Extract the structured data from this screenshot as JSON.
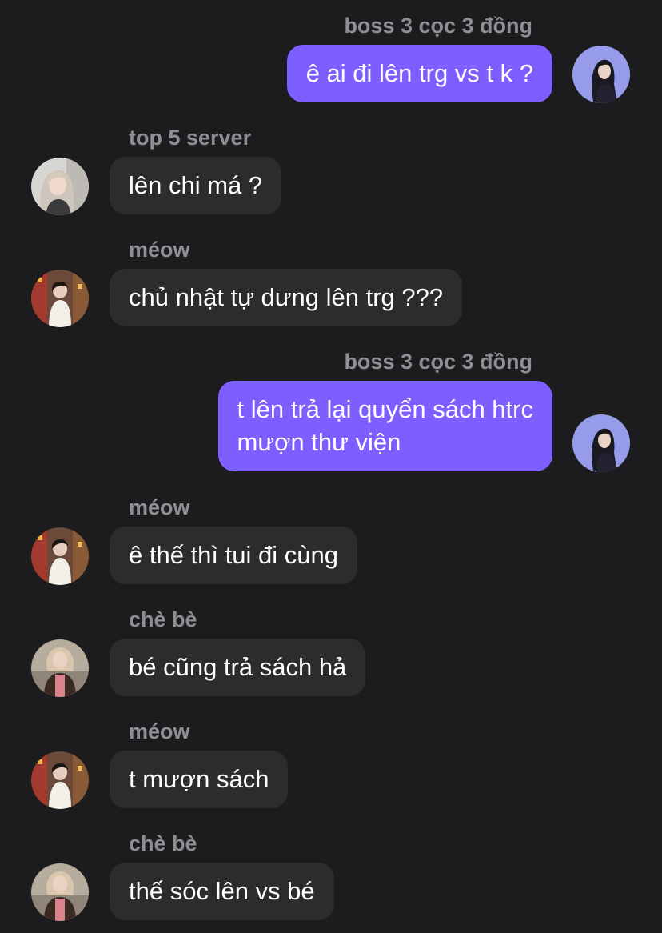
{
  "messages": [
    {
      "sender": "boss 3 cọc 3 đồng",
      "text": "ê ai đi lên trg vs t k ?",
      "direction": "outgoing",
      "avatar": "boss-avatar"
    },
    {
      "sender": "top 5 server",
      "text": "lên chi má ?",
      "direction": "incoming",
      "avatar": "top5-avatar"
    },
    {
      "sender": "méow",
      "text": "chủ nhật tự dưng lên trg ???",
      "direction": "incoming",
      "avatar": "meow-avatar"
    },
    {
      "sender": "boss 3 cọc 3 đồng",
      "text": "t lên trả lại quyển sách htrc\nmượn thư viện",
      "direction": "outgoing",
      "avatar": "boss-avatar"
    },
    {
      "sender": "méow",
      "text": "ê thế thì tui đi cùng",
      "direction": "incoming",
      "avatar": "meow-avatar"
    },
    {
      "sender": "chè bè",
      "text": "bé cũng trả sách hả",
      "direction": "incoming",
      "avatar": "chebe-avatar"
    },
    {
      "sender": "méow",
      "text": "t mượn sách",
      "direction": "incoming",
      "avatar": "meow-avatar"
    },
    {
      "sender": "chè bè",
      "text": "thế sóc lên vs bé",
      "direction": "incoming",
      "avatar": "chebe-avatar"
    }
  ],
  "colors": {
    "background": "#1c1c1e",
    "outgoing_bubble": "#7d5fff",
    "incoming_bubble": "#2c2c2e",
    "sender_name": "#8e8e93",
    "message_text": "#ffffff"
  }
}
